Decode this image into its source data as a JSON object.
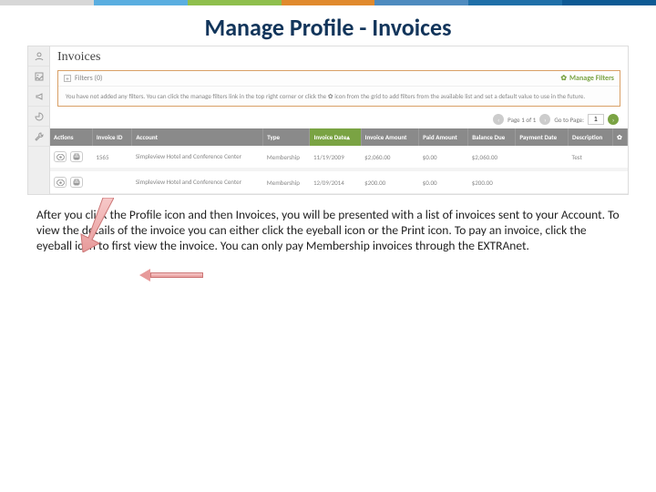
{
  "stripe_colors": [
    "#d7d7d7",
    "#5aaee0",
    "#8fbf4d",
    "#e08a2e",
    "#4e8bbf",
    "#1f6fa8",
    "#0e5a94"
  ],
  "slide_title": "Manage Profile - Invoices",
  "page_heading": "Invoices",
  "filters": {
    "label": "Filters (0)",
    "manage": "Manage Filters",
    "help": "You have not added any filters. You can click the manage filters link in the top right corner or click the ✿ icon from the grid to add filters from the available list and set a default value to use in the future."
  },
  "pager": {
    "page_label": "Page 1 of 1",
    "goto_label": "Go to Page:",
    "goto_value": "1"
  },
  "columns": {
    "actions": "Actions",
    "invoice_id": "Invoice ID",
    "account": "Account",
    "type": "Type",
    "invoice_date": "Invoice Date▴",
    "invoice_amount": "Invoice Amount",
    "paid_amount": "Paid Amount",
    "balance_due": "Balance Due",
    "payment_date": "Payment Date",
    "description": "Description"
  },
  "rows": [
    {
      "invoice_id": "1565",
      "account": "Simpleview Hotel and Conference Center",
      "type": "Membership",
      "invoice_date": "11/19/2009",
      "invoice_amount": "$2,060.00",
      "paid_amount": "$0.00",
      "balance_due": "$2,060.00",
      "payment_date": "",
      "description": "Test"
    },
    {
      "invoice_id": "",
      "account": "Simpleview Hotel and Conference Center",
      "type": "Membership",
      "invoice_date": "12/09/2014",
      "invoice_amount": "$200.00",
      "paid_amount": "$0.00",
      "balance_due": "$200.00",
      "payment_date": "",
      "description": ""
    }
  ],
  "body_text": "After you click the Profile icon and then Invoices, you will be presented with a list of invoices sent to your Account. To view the details of the invoice you can either click the eyeball icon or the Print icon.  To pay an invoice, click the eyeball icon to first view the invoice.  You can only pay Membership invoices through the EXTRAnet."
}
